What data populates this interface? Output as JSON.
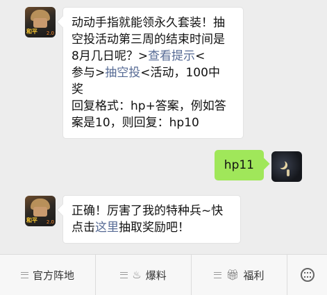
{
  "chat": {
    "message1": {
      "line1": "动动手指就能领永久套装！抽",
      "line2": "空投活动第三周的结束时间是",
      "line3_pre": "8月几日呢？>",
      "line3_link": "查看提示",
      "line3_post": "<",
      "line4_pre": "参与>",
      "line4_link": "抽空投",
      "line4_post": "<活动，100中",
      "line5": "奖",
      "line6": "回复格式：hp+答案，例如答",
      "line7": "案是10，则回复：hp10"
    },
    "message2": {
      "text": "hp11"
    },
    "message3": {
      "line1": "正确！厉害了我的特种兵~快",
      "line2_pre": "点击",
      "line2_link": "这里",
      "line2_post": "抽取奖励吧！"
    },
    "avatar_badge": "2.0",
    "avatar_game_label": "和平",
    "colors": {
      "link": "#576b95",
      "sent_bubble": "#a0e75a",
      "background": "#ededed"
    }
  },
  "menu": {
    "tabs": [
      {
        "label": "官方阵地",
        "icon": "menu-lines-icon"
      },
      {
        "label": "爆料",
        "icon": "flame-icon"
      },
      {
        "label": "福利",
        "icon": "gift-icon"
      }
    ],
    "keyboard_icon": "keyboard-icon"
  }
}
